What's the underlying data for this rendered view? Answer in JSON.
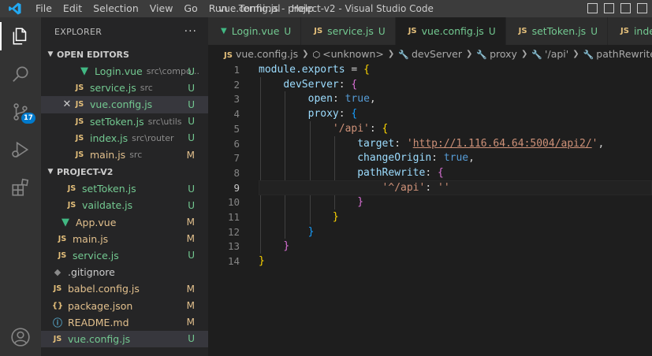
{
  "titlebar": {
    "menu": [
      "File",
      "Edit",
      "Selection",
      "View",
      "Go",
      "Run",
      "Terminal",
      "Help"
    ],
    "title": "vue.config.js - project-v2 - Visual Studio Code"
  },
  "activity_bar": {
    "items": [
      "explorer-icon",
      "search-icon",
      "source-control-icon",
      "run-debug-icon",
      "extensions-icon"
    ],
    "scm_badge": "17",
    "account": "account-icon"
  },
  "sidebar": {
    "title": "EXPLORER",
    "more": "···",
    "open_editors": {
      "label": "OPEN EDITORS",
      "items": [
        {
          "icon": "vue",
          "name": "Login.vue",
          "path": "src\\compo...",
          "status": "U"
        },
        {
          "icon": "js",
          "name": "service.js",
          "path": "src",
          "status": "U"
        },
        {
          "icon": "js",
          "name": "vue.config.js",
          "path": "",
          "status": "U"
        },
        {
          "icon": "js",
          "name": "setToken.js",
          "path": "src\\utils",
          "status": "U"
        },
        {
          "icon": "js",
          "name": "index.js",
          "path": "src\\router",
          "status": "U"
        },
        {
          "icon": "js",
          "name": "main.js",
          "path": "src",
          "status": "M"
        }
      ]
    },
    "project": {
      "label": "PROJECT-V2",
      "items": [
        {
          "icon": "js",
          "name": "setToken.js",
          "status": "U"
        },
        {
          "icon": "js",
          "name": "vaildate.js",
          "status": "U"
        },
        {
          "icon": "vue",
          "name": "App.vue",
          "status": "M"
        },
        {
          "icon": "js",
          "name": "main.js",
          "status": "M"
        },
        {
          "icon": "js",
          "name": "service.js",
          "status": "U"
        },
        {
          "icon": "git",
          "name": ".gitignore",
          "status": ""
        },
        {
          "icon": "js",
          "name": "babel.config.js",
          "status": "M"
        },
        {
          "icon": "json",
          "name": "package.json",
          "status": "M"
        },
        {
          "icon": "info",
          "name": "README.md",
          "status": "M"
        },
        {
          "icon": "js",
          "name": "vue.config.js",
          "status": "U"
        }
      ]
    }
  },
  "tabs": [
    {
      "icon": "vue",
      "name": "Login.vue",
      "status": "U"
    },
    {
      "icon": "js",
      "name": "service.js",
      "status": "U"
    },
    {
      "icon": "js",
      "name": "vue.config.js",
      "status": "U"
    },
    {
      "icon": "js",
      "name": "setToken.js",
      "status": "U"
    },
    {
      "icon": "js",
      "name": "inde",
      "status": ""
    }
  ],
  "breadcrumbs": [
    "vue.config.js",
    "<unknown>",
    "devServer",
    "proxy",
    "'/api'",
    "pathRewrite",
    "'^..."
  ],
  "editor": {
    "current_line": 9,
    "lines": [
      "module.exports = {",
      "    devServer: {",
      "        open: true,",
      "        proxy: {",
      "            '/api': {",
      "                target: 'http://1.116.64.64:5004/api2/',",
      "                changeOrigin: true,",
      "                pathRewrite: {",
      "                    '^/api': ''",
      "                }",
      "            }",
      "        }",
      "    }",
      "}"
    ]
  },
  "colors": {
    "untracked": "#73c991",
    "modified": "#e2c08d",
    "accent": "#007acc"
  }
}
